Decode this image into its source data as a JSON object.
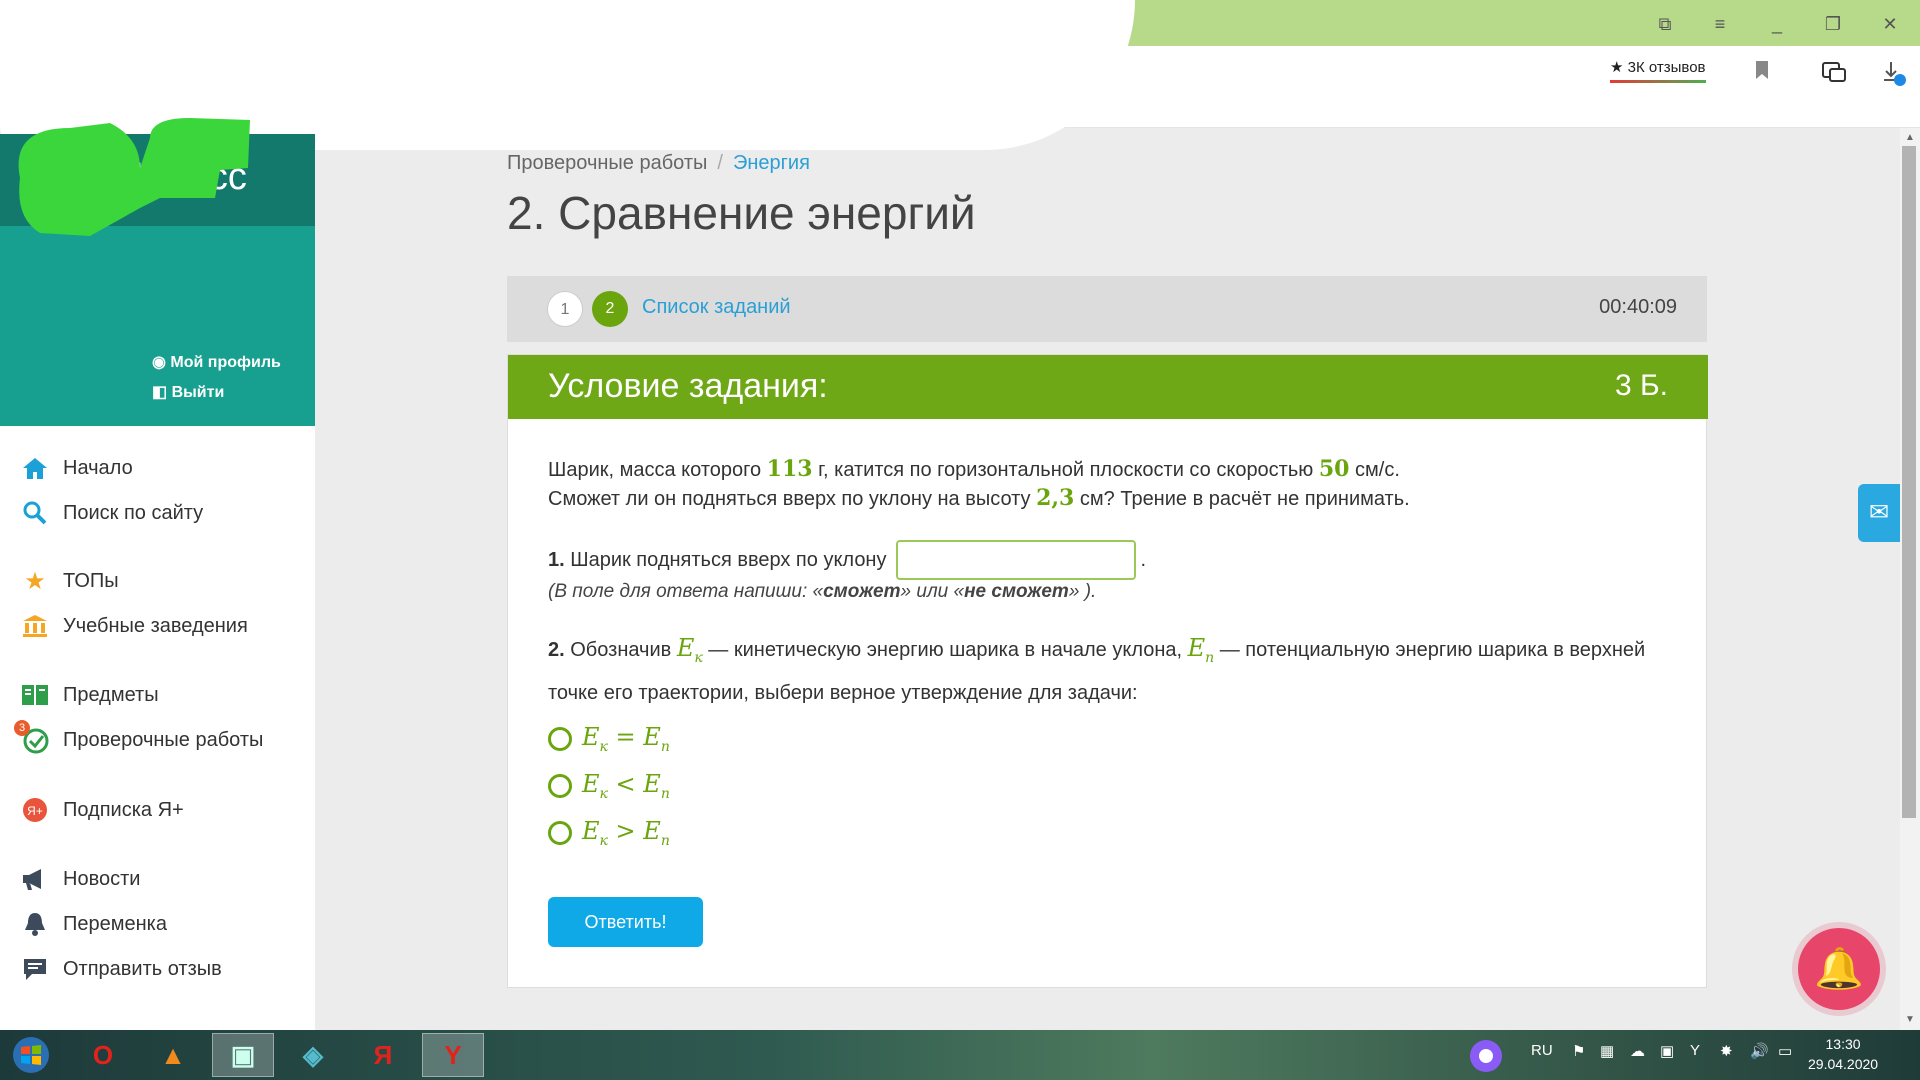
{
  "browser": {
    "reviews_label": "★ 3К отзывов",
    "window_buttons": [
      "⧉",
      "≡",
      "_",
      "❐",
      "✕"
    ]
  },
  "sidebar": {
    "logo_text": "ЯКласс",
    "profile_label": "Мой профиль",
    "logout_label": "Выйти",
    "items": [
      {
        "label": "Начало",
        "icon": "home-icon"
      },
      {
        "label": "Поиск по сайту",
        "icon": "search-icon"
      },
      {
        "label": "ТОПы",
        "icon": "star-icon"
      },
      {
        "label": "Учебные заведения",
        "icon": "school-icon"
      },
      {
        "label": "Предметы",
        "icon": "books-icon"
      },
      {
        "label": "Проверочные работы",
        "icon": "check-icon",
        "badge": "3"
      },
      {
        "label": "Подписка Я+",
        "icon": "subscription-icon"
      },
      {
        "label": "Новости",
        "icon": "megaphone-icon"
      },
      {
        "label": "Переменка",
        "icon": "bell-icon"
      },
      {
        "label": "Отправить отзыв",
        "icon": "feedback-icon"
      }
    ]
  },
  "breadcrumb": {
    "parent": "Проверочные работы",
    "separator": "/",
    "current": "Энергия"
  },
  "page_title": "2. Сравнение энергий",
  "stepbar": {
    "step1": "1",
    "step2": "2",
    "task_list": "Список заданий",
    "timer": "00:40:09"
  },
  "task": {
    "header": "Условие задания:",
    "points": "3 Б.",
    "text1_a": "Шарик, масса которого ",
    "mass": "113",
    "text1_b": " г, катится по горизонтальной плоскости со скоростью ",
    "speed": "50",
    "text1_c": " см/с.",
    "text2_a": "Сможет ли он подняться вверх по уклону на высоту ",
    "height": "2,3",
    "text2_b": " см? Трение в расчёт не принимать.",
    "q1_num": "1.",
    "q1_text": "Шарик подняться вверх по уклону",
    "q1_after": ".",
    "hint_a": "(В поле для ответа напиши: «",
    "hint_b1": "сможет",
    "hint_c": "»  или «",
    "hint_b2": "не сможет",
    "hint_d": "» ).",
    "q2_num": "2.",
    "q2_a": "Обозначив ",
    "q2_b": " — кинетическую энергию шарика в начале уклона, ",
    "q2_c": " — потенциальную энергию шарика в верхней точке его траектории, выбери верное утверждение для задачи:",
    "var_E": "E",
    "sub_k": "к",
    "sub_p": "п",
    "options": [
      " = ",
      " < ",
      " > "
    ],
    "submit": "Ответить!"
  },
  "taskbar": {
    "apps": [
      "O",
      "▲",
      "▣",
      "◈",
      "Я",
      "Y"
    ],
    "lang": "RU",
    "time": "13:30",
    "date": "29.04.2020"
  },
  "colors": {
    "accent_green": "#6ea816",
    "link_blue": "#2a9fd6",
    "brand_teal": "#12796c",
    "submit_blue": "#0fa9e8"
  }
}
